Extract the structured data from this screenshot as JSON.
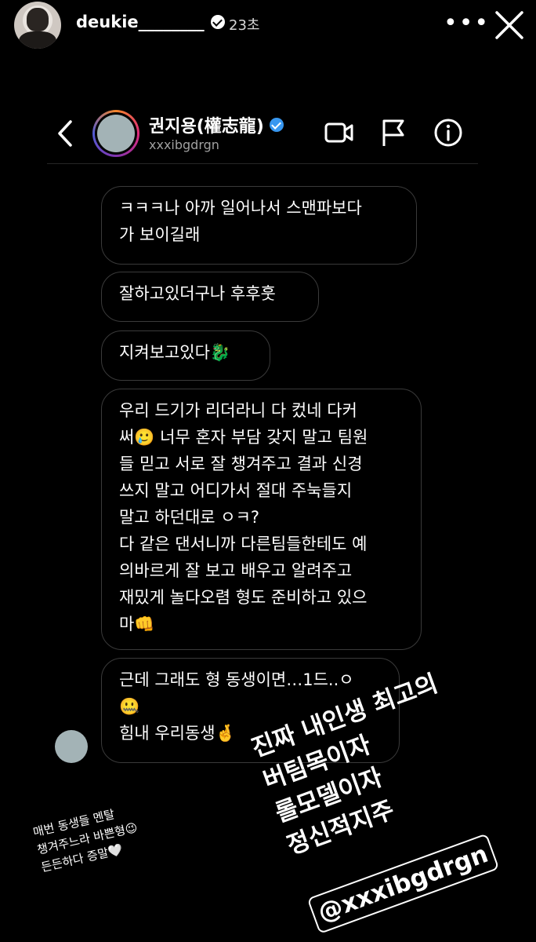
{
  "story": {
    "username": "deukie________",
    "time": "23초"
  },
  "dm": {
    "name": "권지용(權志龍)",
    "handle": "xxxibgdrgn",
    "messages": [
      "ㅋㅋㅋ나 아까 일어나서 스맨파보다\n가 보이길래",
      "잘하고있더구나 후후훗",
      "지켜보고있다🐉",
      "우리 드기가 리더라니 다 컸네 다커\n써🥲 너무 혼자 부담 갖지 말고 팀원\n들 믿고 서로 잘 챙겨주고 결과 신경\n쓰지 말고 어디가서 절대 주눅들지\n말고 하던대로 ㅇㅋ?\n다 같은 댄서니까 다른팀들한테도 예\n의바르게 잘 보고 배우고 알려주고\n재밌게 놀다오렴 형도 준비하고 있으\n마👊",
      "근데 그래도 형 동생이면…1드..ㅇ\n🤐\n힘내 우리동생🤞"
    ]
  },
  "captions": {
    "small": "매번 동생들 멘탈\n챙겨주느라 바쁜형😉\n든든하다 증말🤍",
    "big": "진짜  내인생  최고의\n버팀목이자\n롤모델이자\n정신적지주",
    "mention": "@xxxibgdrgn"
  }
}
